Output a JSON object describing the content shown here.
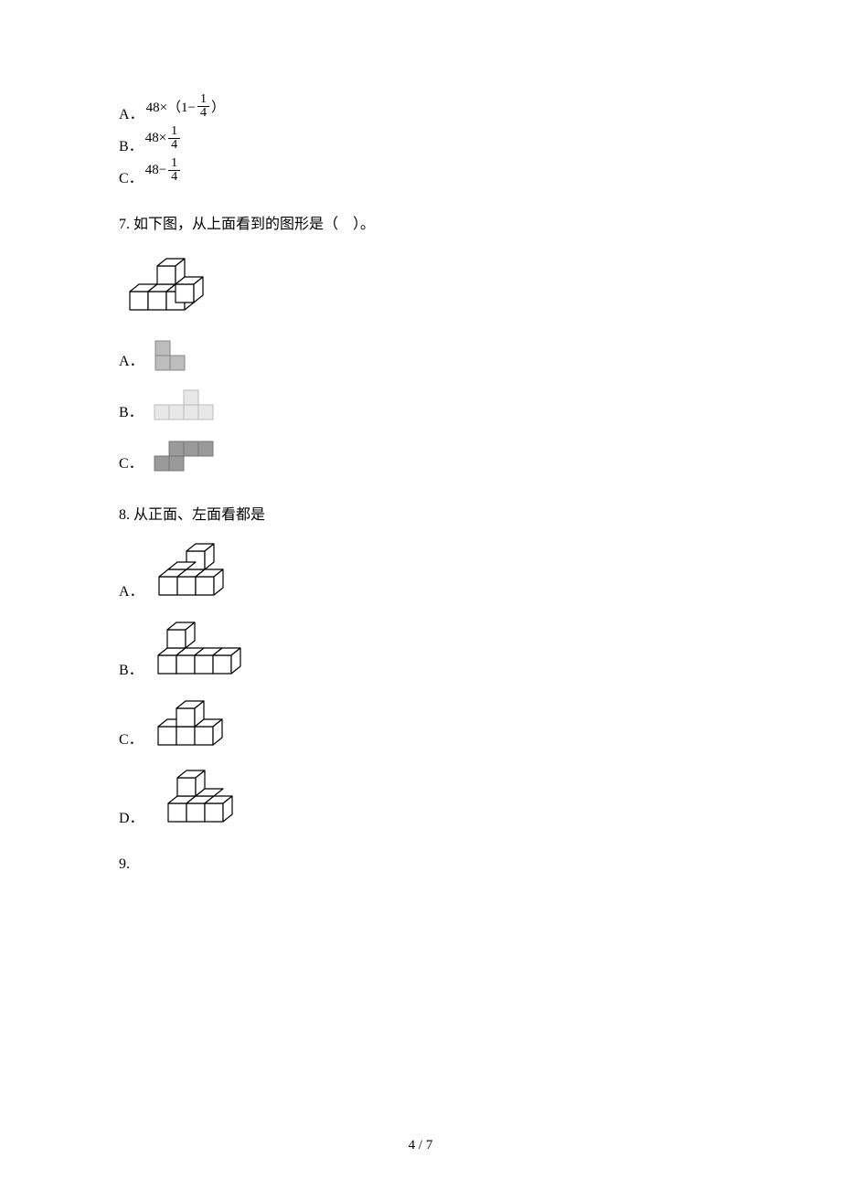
{
  "q6": {
    "options": {
      "a_letter": "A．",
      "b_letter": "B．",
      "c_letter": "C．"
    }
  },
  "q7": {
    "number": "7. ",
    "text": "如下图，从上面看到的图形是（　）。",
    "options": {
      "a_letter": "A．",
      "b_letter": "B．",
      "c_letter": "C．"
    }
  },
  "q8": {
    "number": "8. ",
    "text": "从正面、左面看都是",
    "options": {
      "a_letter": "A．",
      "b_letter": "B．",
      "c_letter": "C．",
      "d_letter": "D．"
    }
  },
  "q9": {
    "number": "9."
  },
  "page_number": "4 / 7"
}
